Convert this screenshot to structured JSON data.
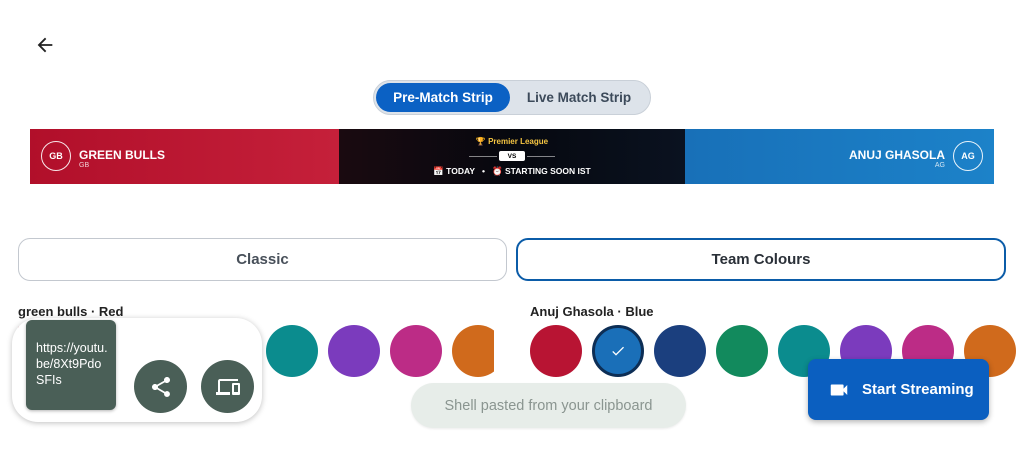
{
  "header": {
    "back_icon": "arrow-left-icon"
  },
  "strip_tabs": [
    {
      "label": "Pre-Match Strip",
      "selected": true
    },
    {
      "label": "Live Match Strip",
      "selected": false
    }
  ],
  "strip": {
    "home": {
      "initials": "GB",
      "name": "GREEN BULLS",
      "short": "GB",
      "color": "#b10f2a"
    },
    "away": {
      "initials": "AG",
      "name": "ANUJ GHASOLA",
      "short": "AG",
      "color": "#1870b8"
    },
    "league": "🏆 Premier League",
    "vs": "VS",
    "date": "📅 TODAY",
    "separator": "•",
    "time": "⏰ STARTING SOON IST"
  },
  "style_tabs": [
    {
      "label": "Classic",
      "selected": false
    },
    {
      "label": "Team Colours",
      "selected": true
    }
  ],
  "home_colours": {
    "label": "green bulls · Red",
    "swatches": [
      "#b01030",
      "#1976c2",
      "#1b3f7e",
      "#128a5d",
      "#0b8c8e",
      "#7b3bbd",
      "#bc2c86",
      "#d06a1c"
    ]
  },
  "away_colours": {
    "label": "Anuj Ghasola · Blue",
    "selected_index": 1,
    "selected_icon": "check-icon",
    "swatches": [
      "#b81433",
      "#1a6fb8",
      "#1b3f7e",
      "#128a5d",
      "#0b8c8e",
      "#7b3bbd",
      "#bc2c86",
      "#d06a1c"
    ]
  },
  "share_panel": {
    "link_text": "https://youtu.be/8Xt9PdoSFIs",
    "share_icon": "share-icon",
    "devices_icon": "devices-icon"
  },
  "toast": "Shell pasted from your clipboard",
  "stream_button": {
    "label": "Start Streaming",
    "icon": "video-camera-icon"
  }
}
